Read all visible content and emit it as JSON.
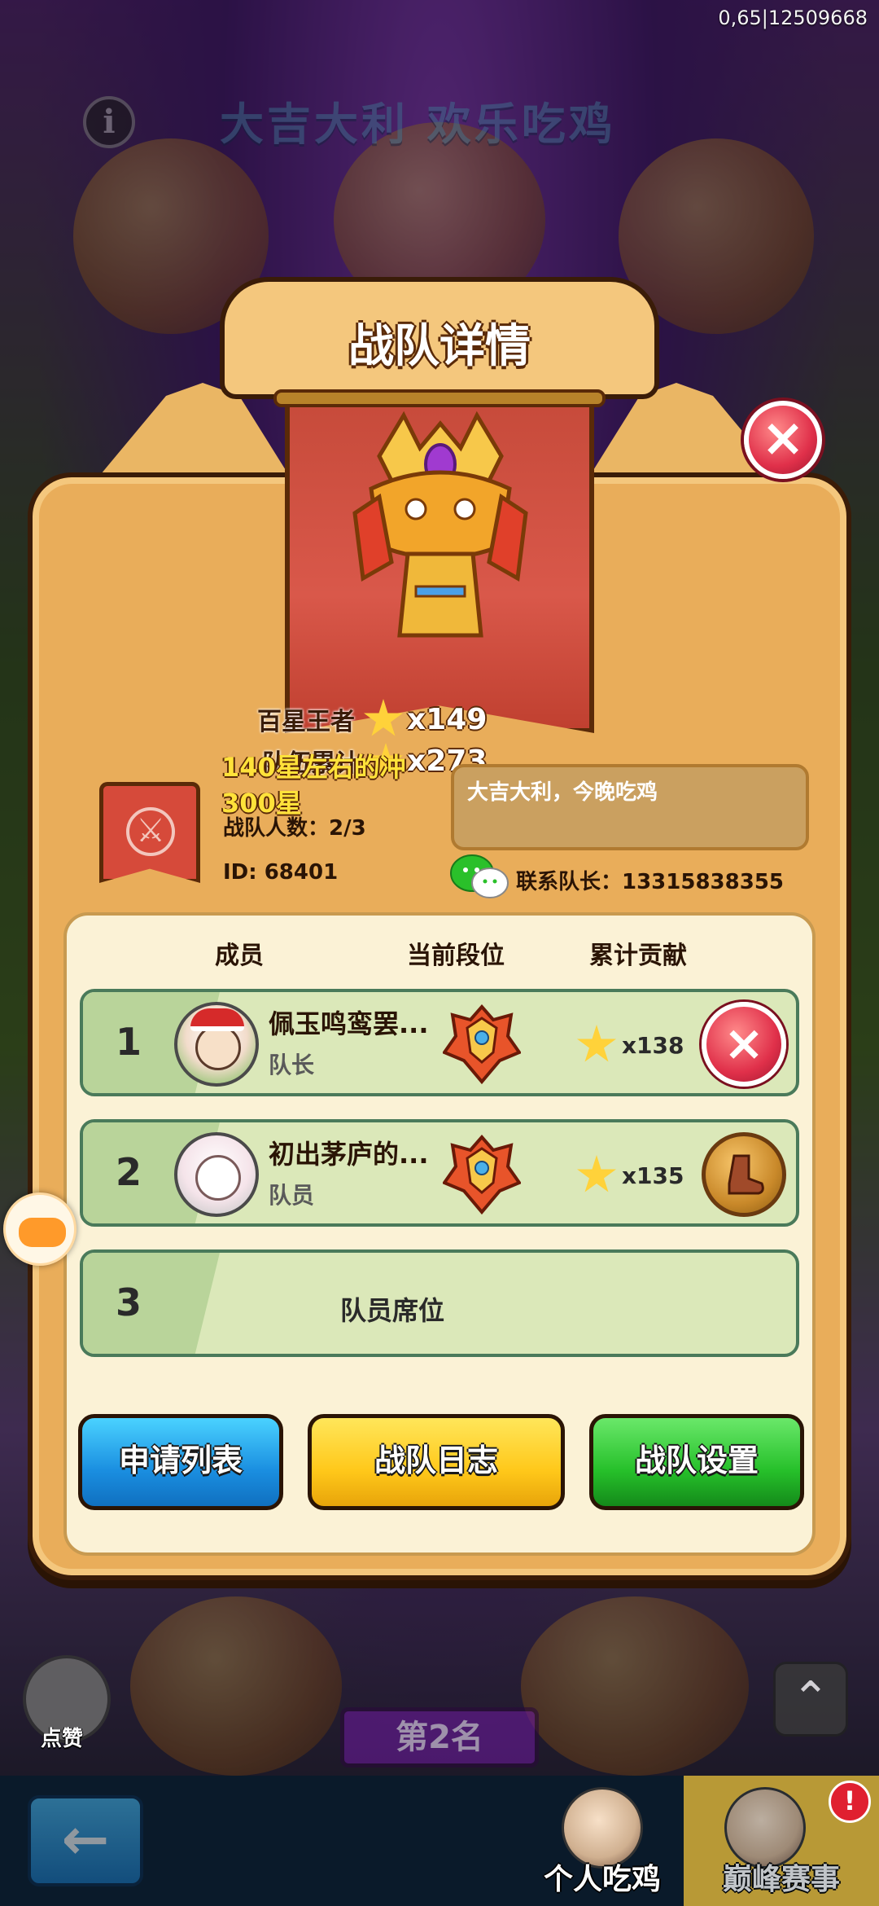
{
  "status": {
    "debug_text": "0,65|12509668"
  },
  "background": {
    "banner_text": "大吉大利 欢乐吃鸡"
  },
  "dialog": {
    "title": "战队详情",
    "close_icon": "close-x-icon",
    "hundred_star_label": "百星王者",
    "hundred_star_value": "x149",
    "team_total_label": "队伍累计",
    "team_total_value": "x273",
    "team_name": "140星左右的冲300星",
    "member_count": "战队人数：2/3",
    "team_id": "ID: 68401",
    "slogan": "大吉大利，今晚吃鸡",
    "contact": "联系队长：13315838355",
    "columns": [
      "成员",
      "当前段位",
      "累计贡献"
    ],
    "members": [
      {
        "num": "1",
        "name": "佩玉鸣鸾罢...",
        "role": "队长",
        "contribution": "x138",
        "action_icon": "kick-x-icon"
      },
      {
        "num": "2",
        "name": "初出茅庐的...",
        "role": "队员",
        "contribution": "x135",
        "action_icon": "boot-icon"
      }
    ],
    "empty_slot": {
      "num": "3",
      "label": "队员席位"
    },
    "buttons": {
      "apply": "申请列表",
      "log": "战队日志",
      "settings": "战队设置"
    }
  },
  "bottom": {
    "like_label": "点赞",
    "rank_label": "第2名",
    "tabs": [
      "个人吃鸡",
      "巅峰赛事"
    ],
    "alert_badge": "!"
  },
  "colors": {
    "dialog_bg": "#e9ad5a",
    "gold_text": "#ffe23a",
    "apply_button": "#1a8ee0",
    "log_button": "#ffc81a",
    "settings_button": "#26c02a"
  }
}
